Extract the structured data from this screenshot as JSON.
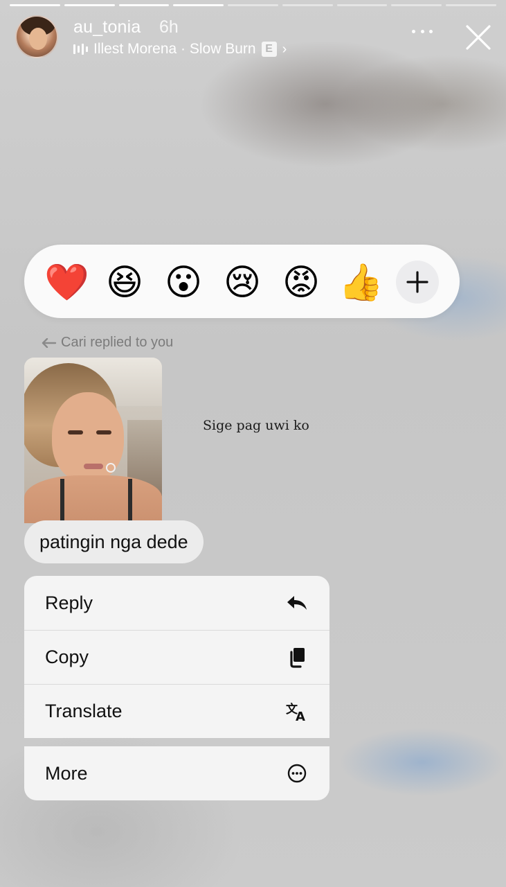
{
  "story": {
    "progress_segments_total": 9,
    "progress_segments_done": 4,
    "username": "au_tonia",
    "time_ago": "6h",
    "music": {
      "icon": "audio-bars-icon",
      "text": "Illest Morena · Slow Burn",
      "explicit_badge": "E"
    },
    "header_icons": [
      "more-options-icon",
      "close-icon"
    ]
  },
  "reactions": {
    "emojis": [
      {
        "name": "red-heart-emoji",
        "glyph": "❤️"
      },
      {
        "name": "laughing-emoji",
        "glyph": "😆"
      },
      {
        "name": "surprised-emoji",
        "glyph": "😮"
      },
      {
        "name": "crying-emoji",
        "glyph": "😢"
      },
      {
        "name": "angry-emoji",
        "glyph": "😡"
      },
      {
        "name": "thumbs-up-emoji",
        "glyph": "👍"
      }
    ],
    "add_icon": "plus-icon"
  },
  "reply": {
    "label": "Cari replied to you"
  },
  "story_preview": {
    "sticker_text": "Sige pag uwi ko"
  },
  "message": {
    "text": "patingin nga dede"
  },
  "menu": {
    "items": [
      {
        "label": "Reply",
        "icon": "reply-arrow-icon"
      },
      {
        "label": "Copy",
        "icon": "copy-icon"
      },
      {
        "label": "Translate",
        "icon": "translate-icon"
      }
    ],
    "more": {
      "label": "More",
      "icon": "more-circle-icon"
    }
  },
  "colors": {
    "menu_bg": "#f4f4f4",
    "reaction_bar_bg": "#fafafa",
    "bubble_bg": "#ececec",
    "text_dark": "#111111",
    "reply_label": "#7b7b7b"
  }
}
